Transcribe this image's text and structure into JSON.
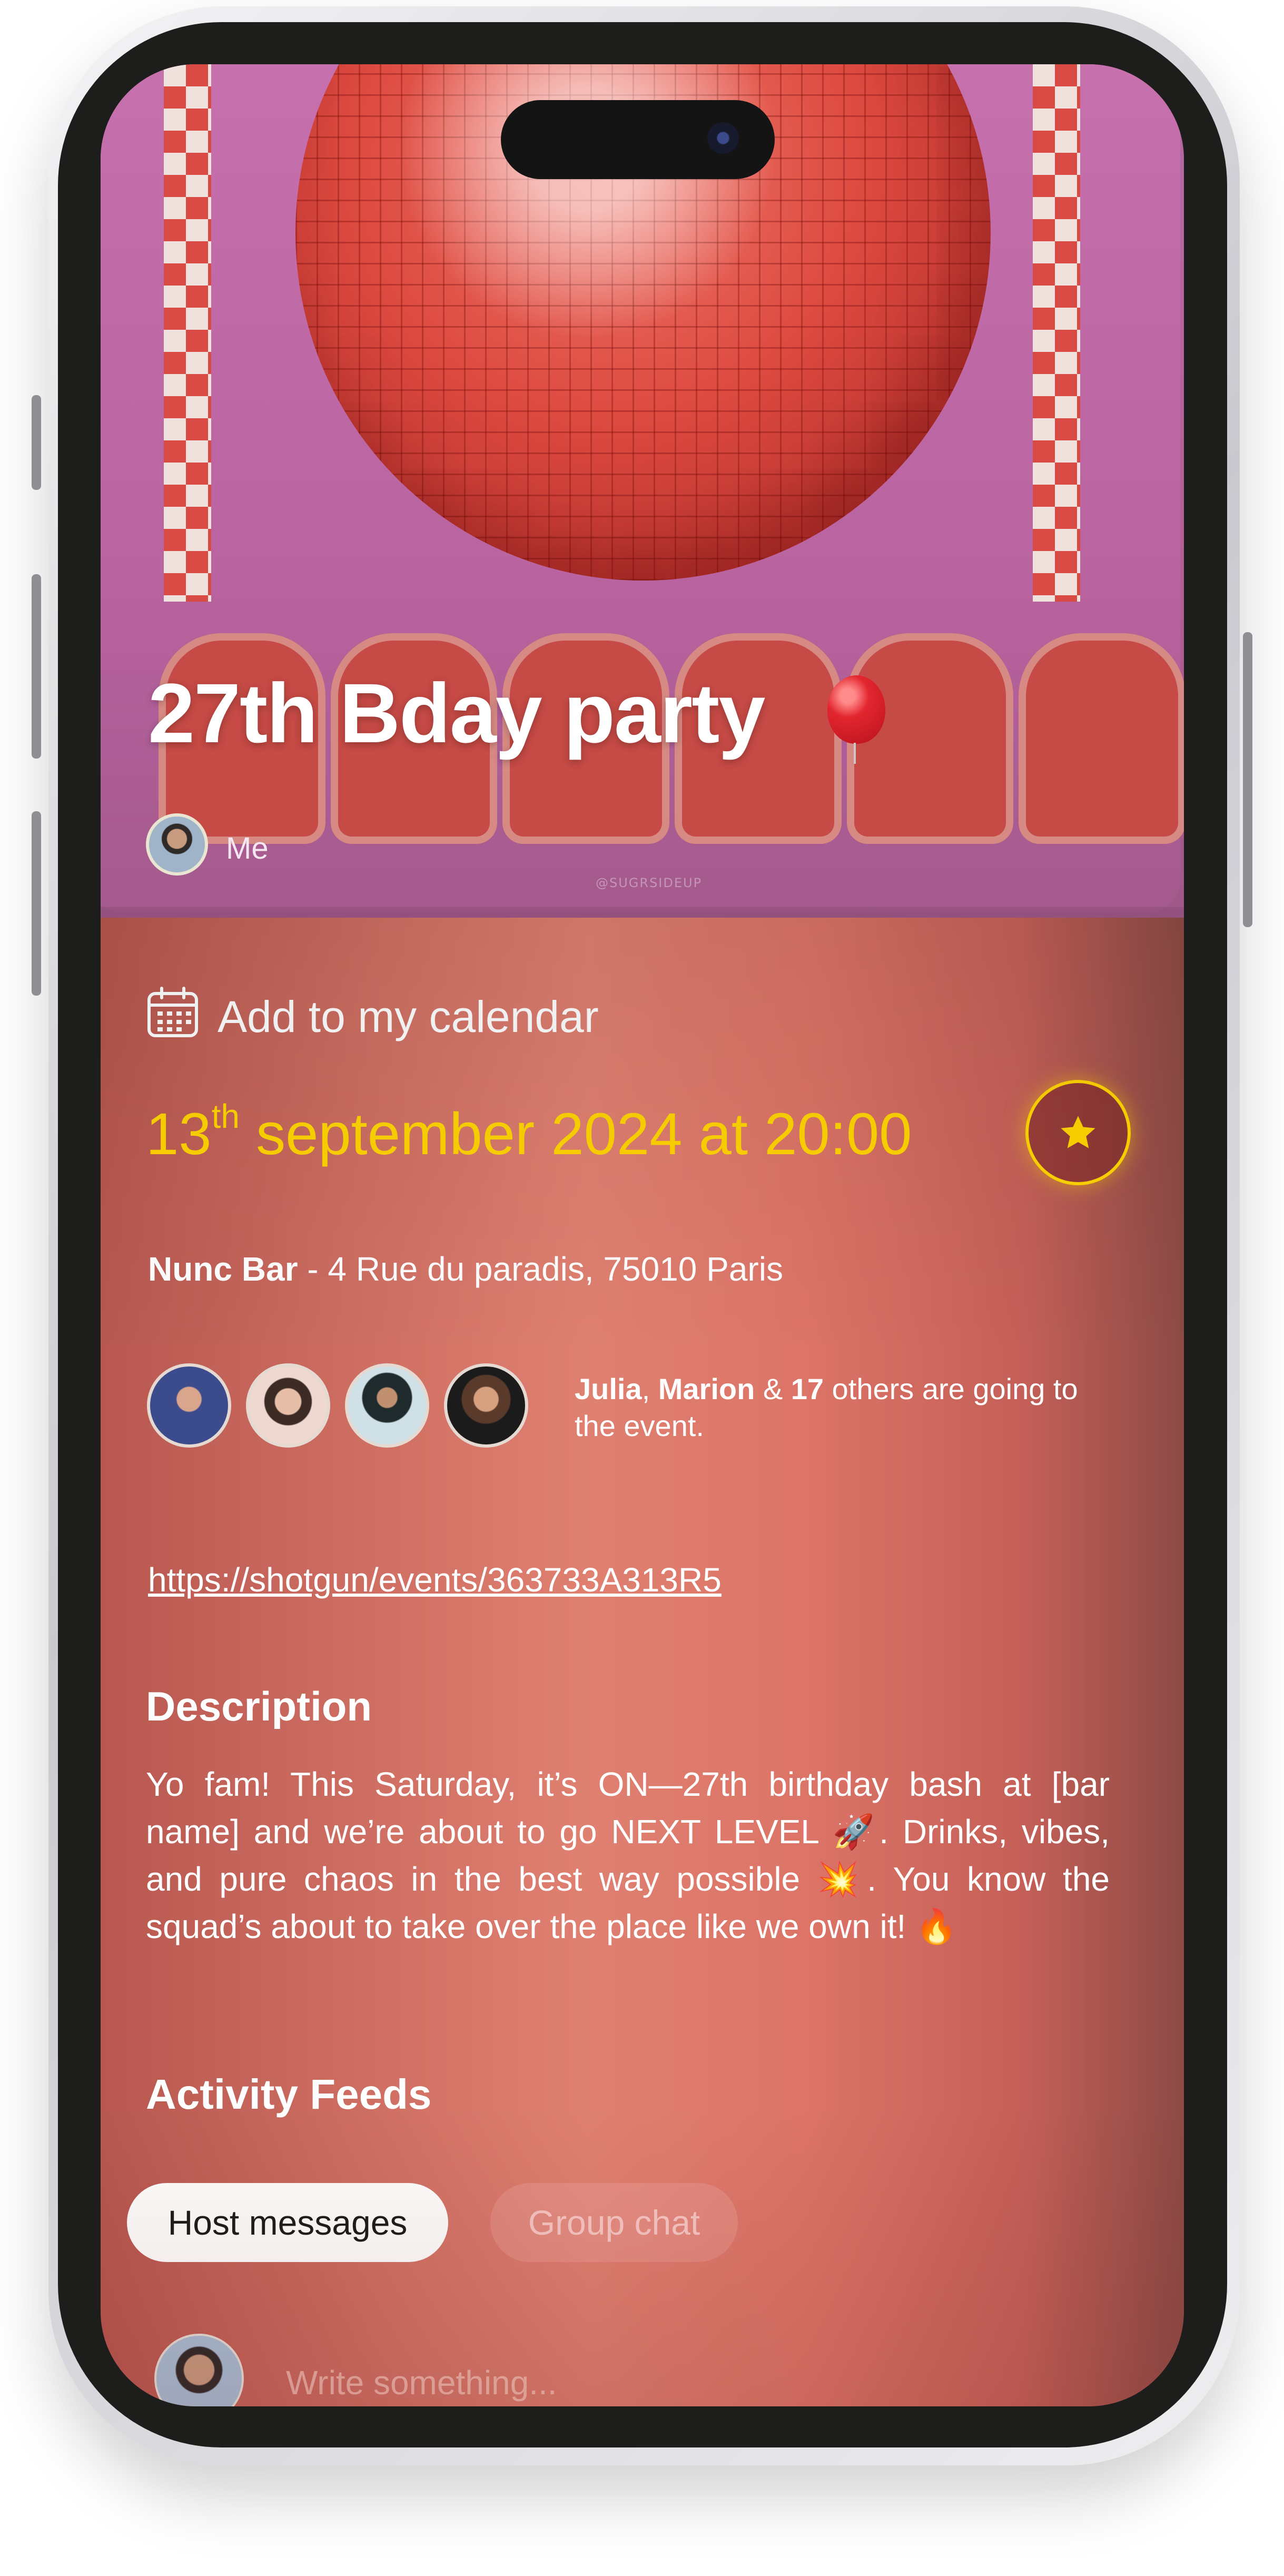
{
  "hero": {
    "title": "27th Bday party",
    "title_emoji": "balloon",
    "host_label": "Me",
    "watermark": "@SUGRSIDEUP"
  },
  "calendar": {
    "label": "Add to my calendar"
  },
  "date": {
    "day": "13",
    "suffix": "th",
    "rest": " september 2024 at 20:00",
    "color": "#ffd400"
  },
  "favorite": {
    "icon": "star-icon"
  },
  "venue": {
    "name": "Nunc Bar",
    "separator": " - ",
    "address": "4 Rue du paradis, 75010 Paris"
  },
  "attendees": {
    "name1": "Julia",
    "name2": "Marion",
    "count": "17",
    "text_mid1": ", ",
    "text_mid2": " & ",
    "text_after_count": " others are going to the event."
  },
  "link": {
    "url": "https://shotgun/events/363733A313R5"
  },
  "description": {
    "heading": "Description",
    "body": "Yo fam! This Saturday, it’s ON—27th birthday bash at [bar name] and we’re about to go NEXT LEVEL 🚀. Drinks, vibes, and pure chaos in the best way possible 💥. You know the squad’s about to take over the place like we own it! 🔥"
  },
  "activity": {
    "heading": "Activity Feeds",
    "tabs": [
      {
        "label": "Host messages",
        "active": true
      },
      {
        "label": "Group chat",
        "active": false
      }
    ],
    "composer_placeholder": "Write something..."
  }
}
